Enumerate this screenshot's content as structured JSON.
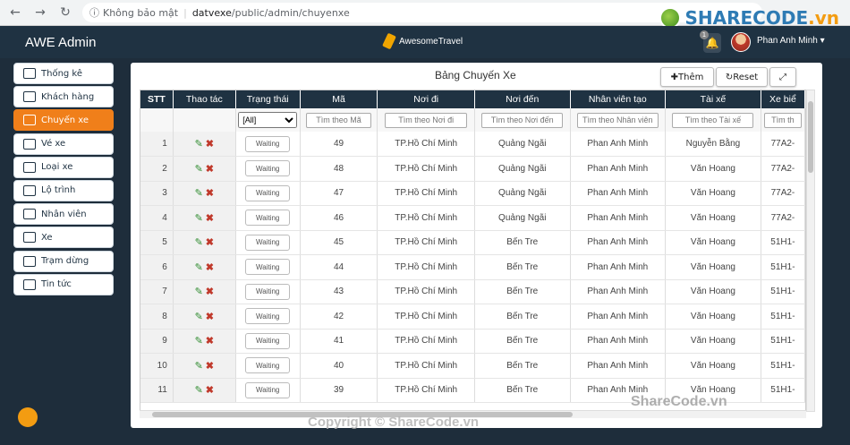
{
  "browser": {
    "security_label": "Không bảo mật",
    "url_host": "datvexe",
    "url_path": "/public/admin/chuyenxe"
  },
  "watermark": {
    "logo_text": "SHARECODE",
    "logo_suffix": ".vn",
    "bottom": "Copyright © ShareCode.vn",
    "right": "ShareCode.vn"
  },
  "header": {
    "app_title": "AWE Admin",
    "brand": "AwesomeTravel",
    "notification_count": "1",
    "user_name": "Phan Anh Minh ▾"
  },
  "sidebar": {
    "items": [
      {
        "label": "Thống kê",
        "icon": "chart-icon"
      },
      {
        "label": "Khách hàng",
        "icon": "users-icon"
      },
      {
        "label": "Chuyến xe",
        "icon": "trip-icon",
        "active": true
      },
      {
        "label": "Vé xe",
        "icon": "ticket-icon"
      },
      {
        "label": "Loại xe",
        "icon": "truck-icon"
      },
      {
        "label": "Lộ trình",
        "icon": "route-icon"
      },
      {
        "label": "Nhân viên",
        "icon": "staff-icon"
      },
      {
        "label": "Xe",
        "icon": "bus-icon"
      },
      {
        "label": "Trạm dừng",
        "icon": "stop-icon"
      },
      {
        "label": "Tin tức",
        "icon": "news-icon"
      }
    ]
  },
  "panel": {
    "title": "Bảng Chuyến Xe",
    "add_label": "✚Thêm",
    "reset_label": "↻Reset",
    "expand_label": "⤢"
  },
  "table": {
    "columns": [
      "STT",
      "Thao tác",
      "Trạng thái",
      "Mã",
      "Nơi đi",
      "Nơi đến",
      "Nhân viên tạo",
      "Tài xế",
      "Xe biể"
    ],
    "status_filter": "[All]",
    "placeholders": [
      "Tìm theo Mã",
      "Tìm theo Nơi đi",
      "Tìm theo Nơi đến",
      "Tìm theo Nhân viên",
      "Tìm theo Tài xế",
      "Tìm th"
    ],
    "rows": [
      {
        "stt": "1",
        "status": "Waiting",
        "ma": "49",
        "noi_di": "TP.Hồ Chí Minh",
        "noi_den": "Quảng Ngãi",
        "nhan_vien": "Phan Anh Minh",
        "tai_xe": "Nguyễn Bằng",
        "xe": "77A2-"
      },
      {
        "stt": "2",
        "status": "Waiting",
        "ma": "48",
        "noi_di": "TP.Hồ Chí Minh",
        "noi_den": "Quảng Ngãi",
        "nhan_vien": "Phan Anh Minh",
        "tai_xe": "Văn Hoang",
        "xe": "77A2-"
      },
      {
        "stt": "3",
        "status": "Waiting",
        "ma": "47",
        "noi_di": "TP.Hồ Chí Minh",
        "noi_den": "Quảng Ngãi",
        "nhan_vien": "Phan Anh Minh",
        "tai_xe": "Văn Hoang",
        "xe": "77A2-"
      },
      {
        "stt": "4",
        "status": "Waiting",
        "ma": "46",
        "noi_di": "TP.Hồ Chí Minh",
        "noi_den": "Quảng Ngãi",
        "nhan_vien": "Phan Anh Minh",
        "tai_xe": "Văn Hoang",
        "xe": "77A2-"
      },
      {
        "stt": "5",
        "status": "Waiting",
        "ma": "45",
        "noi_di": "TP.Hồ Chí Minh",
        "noi_den": "Bến Tre",
        "nhan_vien": "Phan Anh Minh",
        "tai_xe": "Văn Hoang",
        "xe": "51H1-"
      },
      {
        "stt": "6",
        "status": "Waiting",
        "ma": "44",
        "noi_di": "TP.Hồ Chí Minh",
        "noi_den": "Bến Tre",
        "nhan_vien": "Phan Anh Minh",
        "tai_xe": "Văn Hoang",
        "xe": "51H1-"
      },
      {
        "stt": "7",
        "status": "Waiting",
        "ma": "43",
        "noi_di": "TP.Hồ Chí Minh",
        "noi_den": "Bến Tre",
        "nhan_vien": "Phan Anh Minh",
        "tai_xe": "Văn Hoang",
        "xe": "51H1-"
      },
      {
        "stt": "8",
        "status": "Waiting",
        "ma": "42",
        "noi_di": "TP.Hồ Chí Minh",
        "noi_den": "Bến Tre",
        "nhan_vien": "Phan Anh Minh",
        "tai_xe": "Văn Hoang",
        "xe": "51H1-"
      },
      {
        "stt": "9",
        "status": "Waiting",
        "ma": "41",
        "noi_di": "TP.Hồ Chí Minh",
        "noi_den": "Bến Tre",
        "nhan_vien": "Phan Anh Minh",
        "tai_xe": "Văn Hoang",
        "xe": "51H1-"
      },
      {
        "stt": "10",
        "status": "Waiting",
        "ma": "40",
        "noi_di": "TP.Hồ Chí Minh",
        "noi_den": "Bến Tre",
        "nhan_vien": "Phan Anh Minh",
        "tai_xe": "Văn Hoang",
        "xe": "51H1-"
      },
      {
        "stt": "11",
        "status": "Waiting",
        "ma": "39",
        "noi_di": "TP.Hồ Chí Minh",
        "noi_den": "Bến Tre",
        "nhan_vien": "Phan Anh Minh",
        "tai_xe": "Văn Hoang",
        "xe": "51H1-"
      }
    ]
  },
  "colors": {
    "header_bg": "#1f3242",
    "accent": "#f07f1a"
  }
}
